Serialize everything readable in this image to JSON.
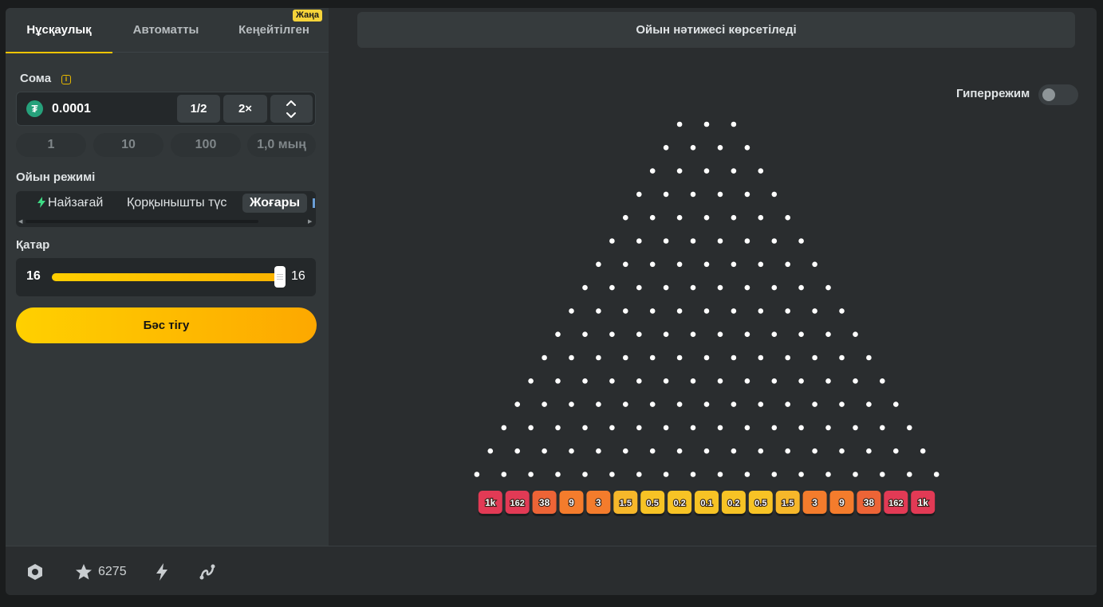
{
  "tabs": [
    "Нұсқаулық",
    "Автоматты",
    "Кеңейтілген"
  ],
  "new_badge": "Жаңа",
  "amount": {
    "label": "Сома",
    "value": "0.0001",
    "coin_icon": "tether-usdt-icon",
    "half_label": "1/2",
    "double_label": "2×"
  },
  "quick_amounts": [
    "1",
    "10",
    "100",
    "1,0 мың"
  ],
  "mode": {
    "label": "Ойын режимі",
    "options": [
      "Найзағай",
      "Қорқынышты түс",
      "Жоғары"
    ],
    "selected": "Жоғары"
  },
  "rows": {
    "label": "Қатар",
    "min_value": "16",
    "max_value": "16",
    "fill_fraction": 1.0
  },
  "bet_button": "Бәс тігу",
  "result_text": "Ойын нәтижесі көрсетіледі",
  "hyper_mode": {
    "label": "Гиперрежим",
    "on": false
  },
  "board": {
    "first_row_pegs": 3,
    "peg_rows": 16,
    "multipliers": [
      "1k",
      "162",
      "38",
      "9",
      "3",
      "1.5",
      "0.5",
      "0.2",
      "0.1",
      "0.2",
      "0.5",
      "1.5",
      "3",
      "9",
      "38",
      "162",
      "1k"
    ],
    "slot_tiers": [
      5,
      5,
      4,
      3,
      3,
      2,
      1,
      1,
      1,
      1,
      1,
      2,
      3,
      3,
      4,
      5,
      5
    ],
    "tier_colors": {
      "1": "#f7c325",
      "2": "#f6b72a",
      "3": "#f47c2c",
      "4": "#ed6436",
      "5": "#e23a55"
    }
  },
  "footer": {
    "icons": [
      "settings-hex-icon",
      "star-icon",
      "lightning-icon",
      "route-icon"
    ],
    "favorites_count": "6275"
  }
}
